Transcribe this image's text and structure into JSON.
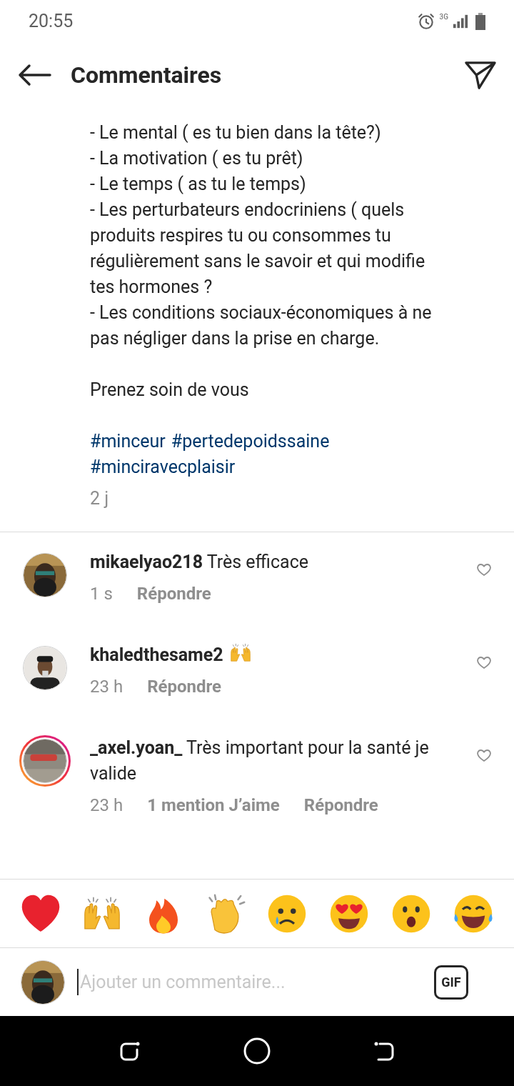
{
  "status_bar": {
    "time": "20:55",
    "network": "3G"
  },
  "header": {
    "title": "Commentaires"
  },
  "caption": {
    "paragraphs": [
      [
        "- Le mental ( es tu bien dans la tête?)",
        "- La motivation ( es tu prêt)",
        "- Le temps ( as tu le temps)",
        "- Les perturbateurs endocriniens ( quels produits respires tu ou consommes tu régulièrement sans le savoir et qui modifie tes hormones ?",
        "- Les conditions sociaux-économiques à ne pas négliger dans la prise en charge."
      ],
      [
        "Prenez soin de vous"
      ]
    ],
    "hashtags": [
      "#minceur",
      "#pertedepoidssaine",
      "#minciravecplaisir"
    ],
    "time": "2 j"
  },
  "comments": [
    {
      "username": "mikaelyao218",
      "text": "Très efficace",
      "time": "1 s",
      "reply": "Répondre",
      "liked": false
    },
    {
      "username": "khaledthesame2",
      "emoji": true,
      "time": "23 h",
      "reply": "Répondre",
      "liked": false
    },
    {
      "username": "_axel.yoan_",
      "text": "Très important pour la santé je valide",
      "time": "23 h",
      "likes": "1 mention J’aime",
      "reply": "Répondre",
      "story": true,
      "liked": false
    }
  ],
  "composer": {
    "placeholder": "Ajouter un commentaire...",
    "gif": "GIF"
  }
}
